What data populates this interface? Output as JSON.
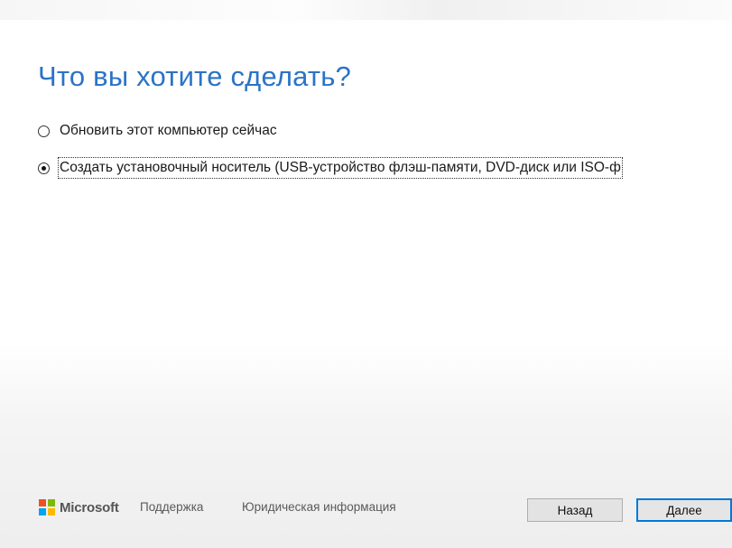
{
  "page": {
    "title": "Что вы хотите сделать?"
  },
  "options": [
    {
      "label": "Обновить этот компьютер сейчас",
      "selected": false
    },
    {
      "label": "Создать установочный носитель (USB-устройство флэш-памяти, DVD-диск или ISO-ф",
      "selected": true
    }
  ],
  "footer": {
    "brand": "Microsoft",
    "support_link": "Поддержка",
    "legal_link": "Юридическая информация",
    "back_button": "Назад",
    "next_button": "Далее"
  },
  "colors": {
    "title": "#2b73c7",
    "accent": "#0078d7"
  }
}
